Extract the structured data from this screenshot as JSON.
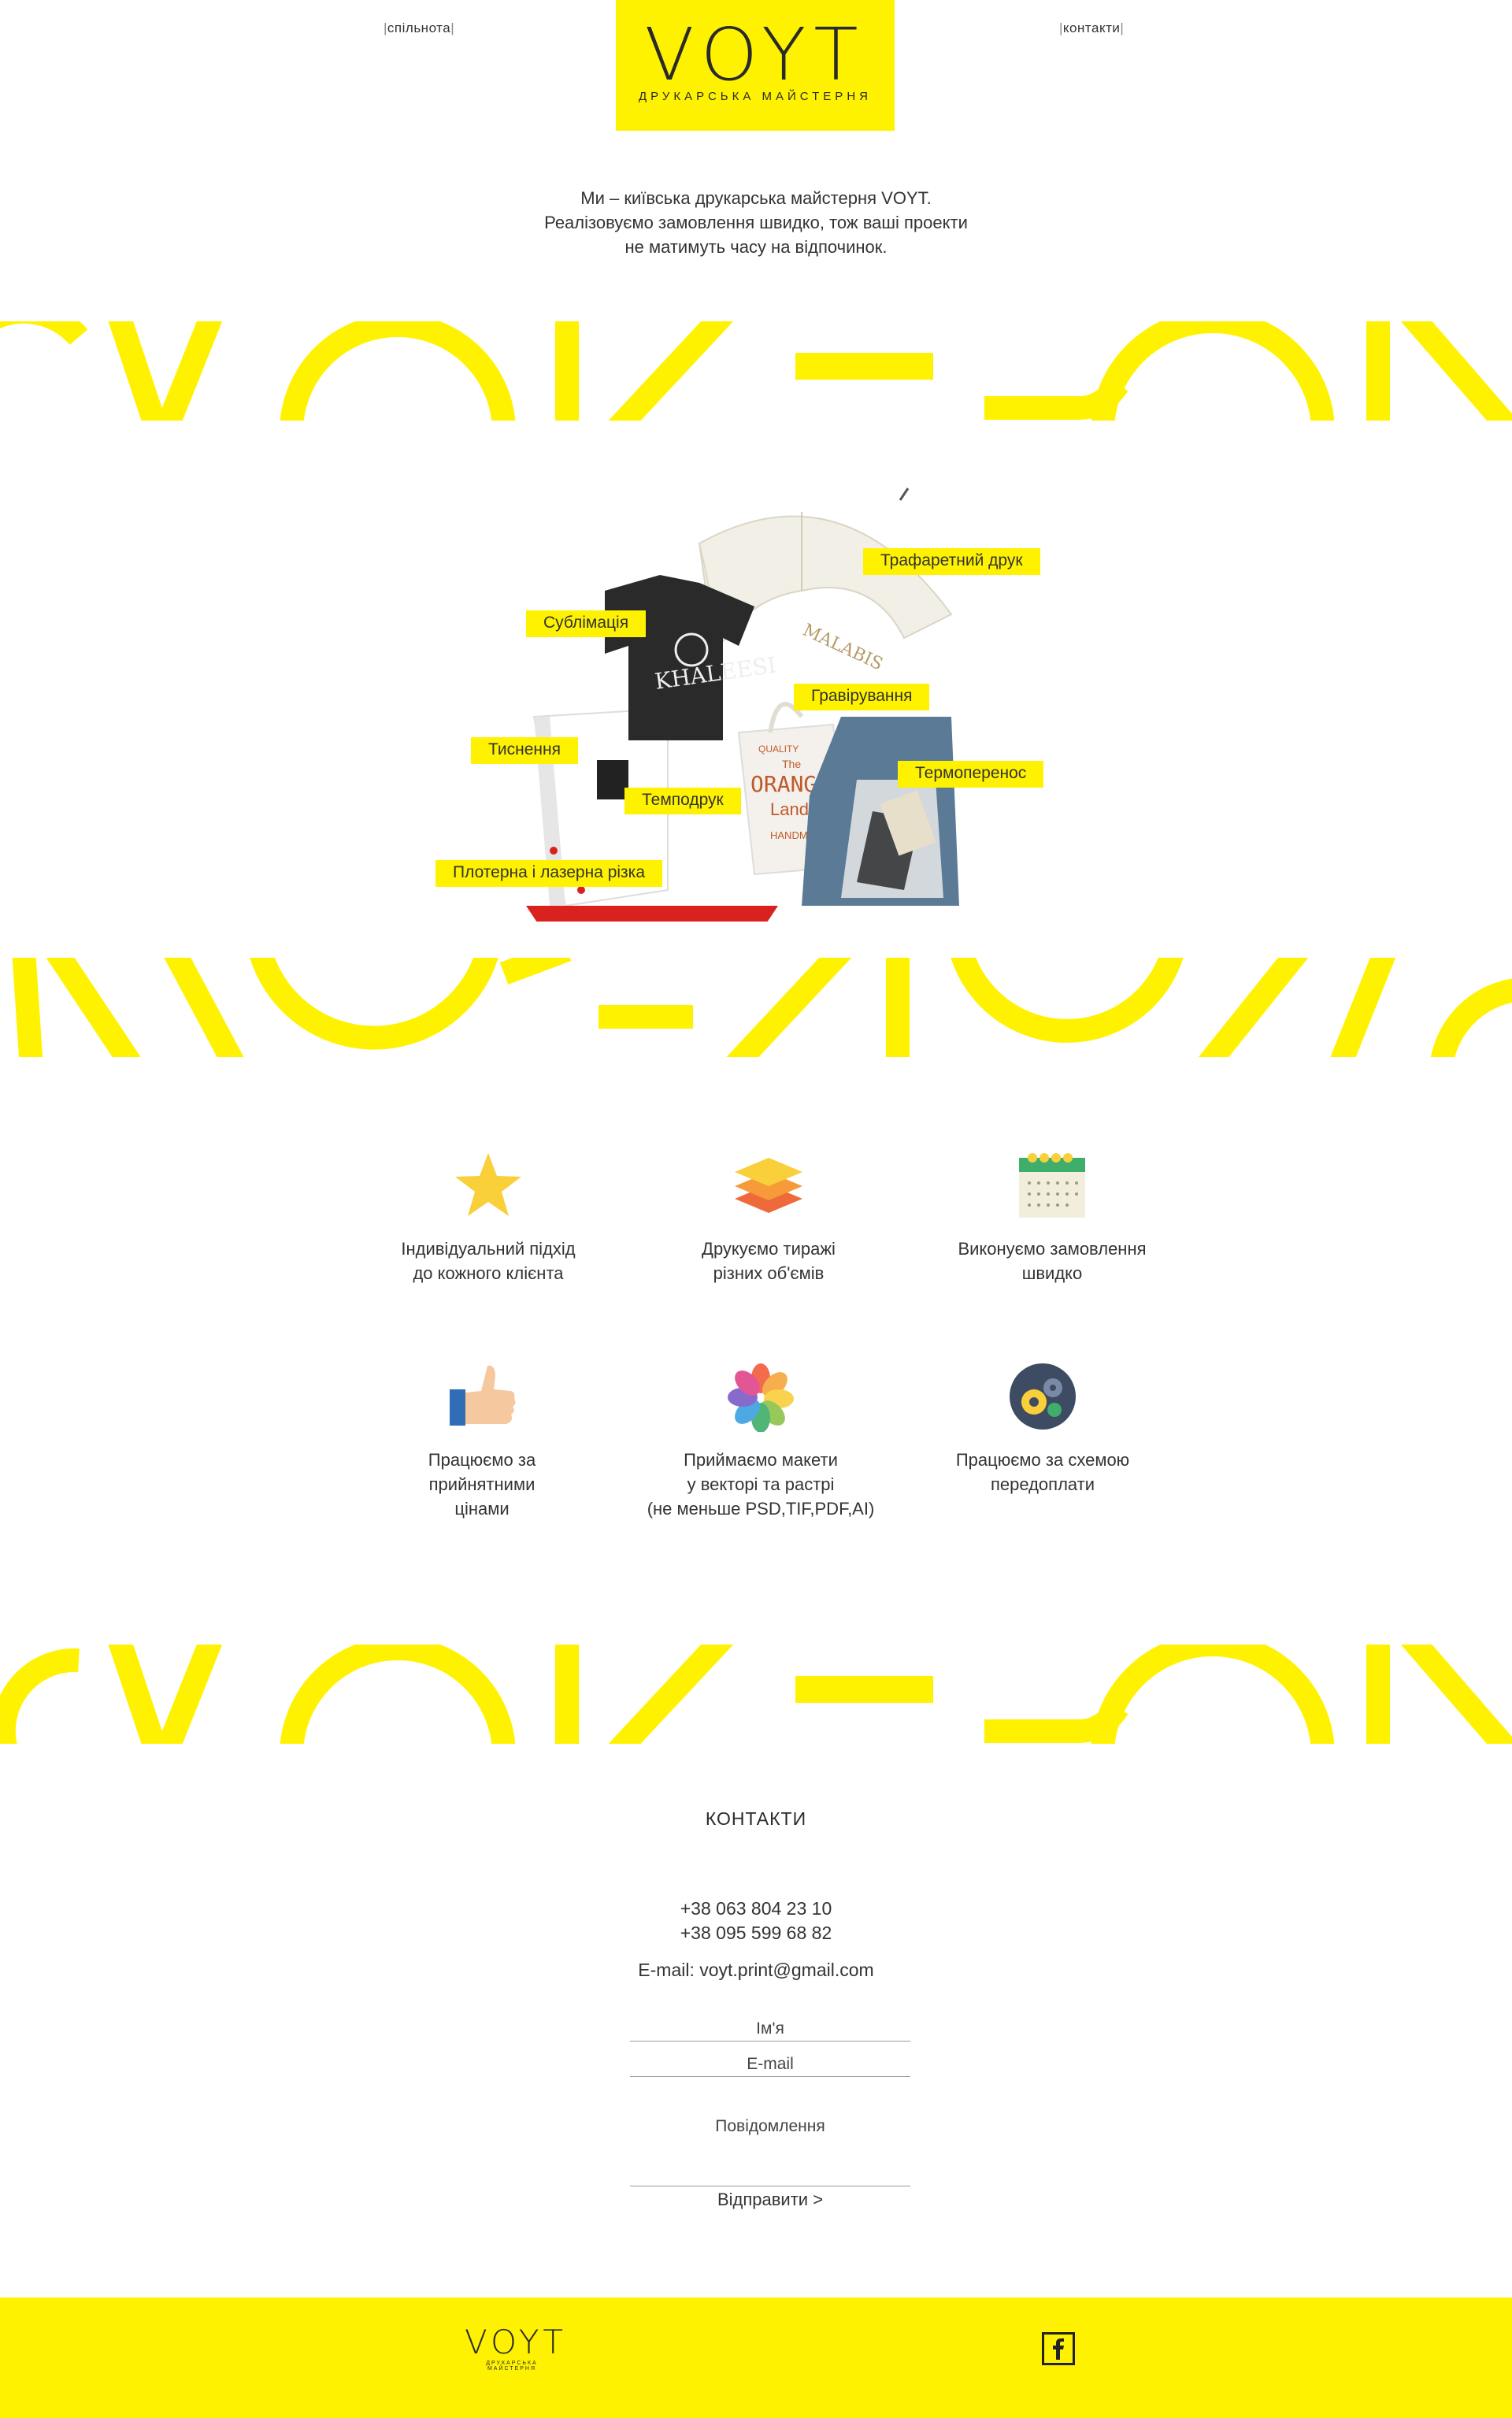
{
  "header": {
    "nav_left": "спільнота",
    "nav_right": "контакти",
    "logo_word": "VOYT",
    "logo_sub": "ДРУКАРСЬКА   МАЙСТЕРНЯ"
  },
  "intro": {
    "line1": "Ми – київська друкарська майстерня VOYT.",
    "line2": "Реалізовуємо замовлення швидко, тож ваші проекти",
    "line3": "не матимуть часу на відпочинок."
  },
  "colors": {
    "accent": "#fff200",
    "text": "#2b2b2b"
  },
  "hero": {
    "tags": {
      "screen": "Трафаретний друк",
      "sublimation": "Сублімація",
      "engraving": "Гравірування",
      "embossing": "Тиснення",
      "thermal": "Термоперенос",
      "pad": "Темподрук",
      "cutting": "Плотерна і лазерна різка"
    },
    "shirt_print": "KHALEESI",
    "umbrella_print": "MALABIS",
    "bag_print_1": "QUALITY",
    "bag_print_2": "The",
    "bag_print_3": "ORANGE",
    "bag_print_4": "Land",
    "bag_print_5": "HANDMADE"
  },
  "features": [
    {
      "icon": "star-icon",
      "text": "Індивідуальний підхід\nдо кожного клієнта"
    },
    {
      "icon": "layers-icon",
      "text": "Друкуємо тиражі\nрізних об'ємів"
    },
    {
      "icon": "calendar-icon",
      "text": "Виконуємо замовлення\nшвидко"
    },
    {
      "icon": "thumbs-up-icon",
      "text": "Працюємо за\nприйнятними\nцінами"
    },
    {
      "icon": "color-wheel-icon",
      "text": "Приймаємо макети\nу векторі та растрі\n(не меньше PSD,TIF,PDF,AI)"
    },
    {
      "icon": "gears-icon",
      "text": "Працюємо за схемою\nпередоплати"
    }
  ],
  "contacts": {
    "title": "КОНТАКТИ",
    "phone1": "+38 063 804 23 10",
    "phone2": "+38 095 599 68 82",
    "email": "E-mail: voyt.print@gmail.com"
  },
  "form": {
    "name_placeholder": "Ім'я",
    "email_placeholder": "E-mail",
    "message_placeholder": "Повідомлення",
    "submit_label": "Відправити >"
  },
  "footer": {
    "logo_word": "VOYT",
    "logo_sub": "ДРУКАРСЬКА МАЙСТЕРНЯ",
    "facebook_icon": "facebook-icon"
  }
}
